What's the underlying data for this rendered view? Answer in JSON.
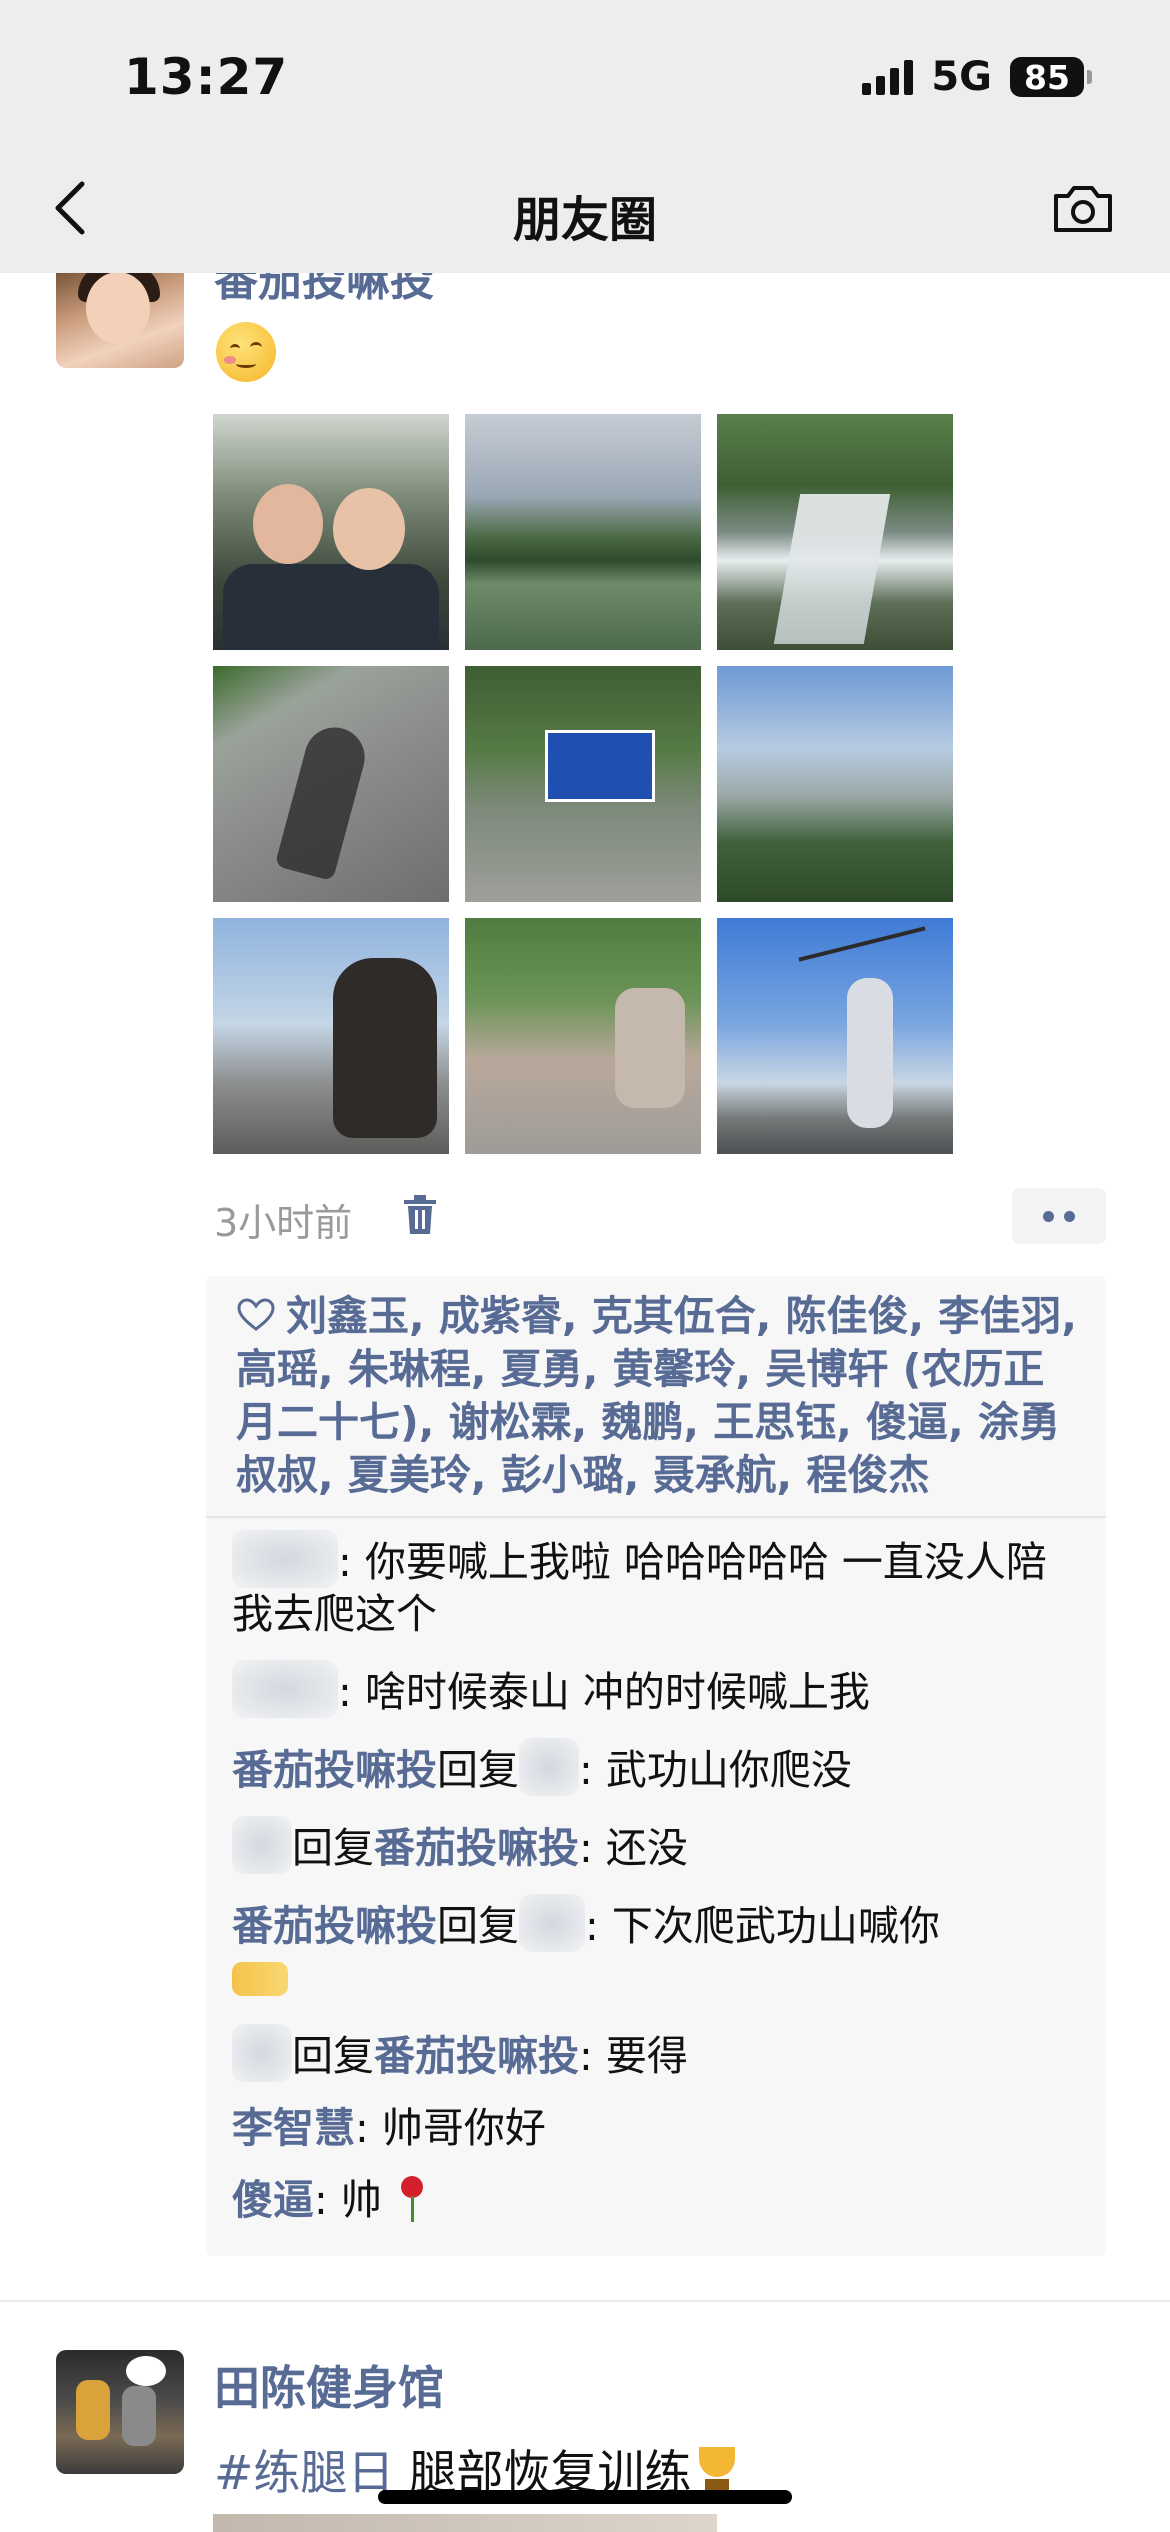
{
  "status_bar": {
    "time": "13:27",
    "network": "5G",
    "battery": "85"
  },
  "nav": {
    "title": "朋友圈"
  },
  "post1": {
    "author": "番茄投嘛投",
    "time": "3小时前",
    "likes": "刘鑫玉, 成紫睿, 克其伍合, 陈佳俊, 李佳羽, 高瑶, 朱琳程, 夏勇, 黄馨玲, 吴博轩 (农历正月二十七), 谢松霖, 魏鹏, 王思钰, 傻逼, 涂勇叔叔, 夏美玲, 彭小璐, 聂承航, 程俊杰",
    "comments": [
      {
        "text": ": 你要喊上我啦 哈哈哈哈哈 一直没人陪我去爬这个"
      },
      {
        "text": ": 啥时候泰山 冲的时候喊上我"
      },
      {
        "from": "番茄投嘛投",
        "reply_word": "回复",
        "text": ": 武功山你爬没"
      },
      {
        "reply_word": "回复",
        "to": "番茄投嘛投",
        "text": ": 还没"
      },
      {
        "from": "番茄投嘛投",
        "reply_word": "回复",
        "text": ": 下次爬武功山喊你"
      },
      {
        "reply_word": "回复",
        "to": "番茄投嘛投",
        "text": ": 要得"
      },
      {
        "from": "李智慧",
        "text": ": 帅哥你好"
      },
      {
        "from": "傻逼",
        "text": ": 帅"
      }
    ]
  },
  "post2": {
    "author": "田陈健身馆",
    "hashtag": "#练腿日",
    "text": " 腿部恢复训练"
  },
  "colors": {
    "link": "#576b95",
    "nav_bg": "#ededed",
    "time_gray": "#9a9a9a"
  },
  "icons": [
    "back-arrow-icon",
    "camera-icon",
    "trash-icon",
    "more-icon",
    "heart-icon",
    "rose-emoji",
    "trophy-emoji"
  ]
}
